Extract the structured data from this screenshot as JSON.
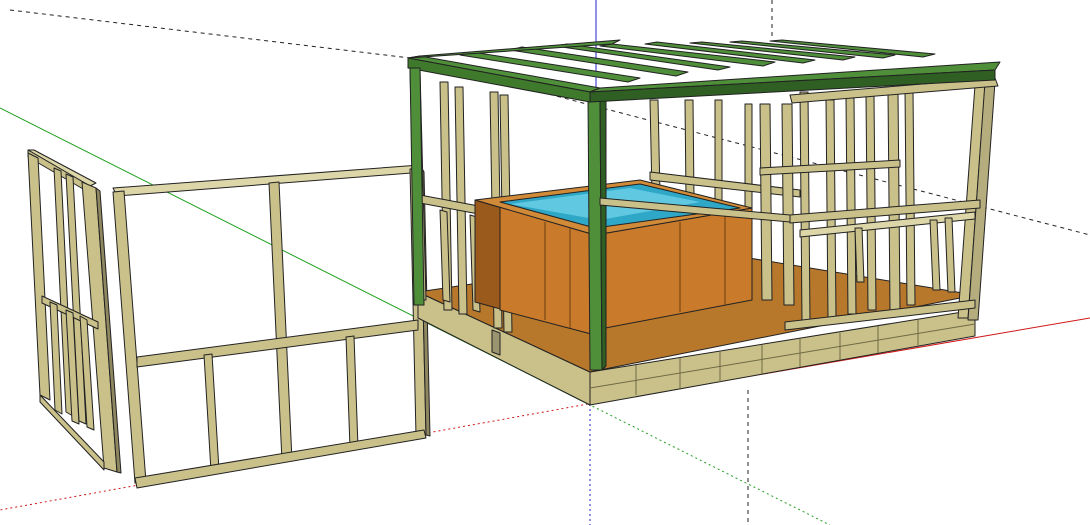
{
  "scene": {
    "description_visible_text": "",
    "colors": {
      "background": "#ffffff",
      "axis_red": "#d01818",
      "axis_green": "#20a020",
      "axis_blue": "#2020c8",
      "lumber": "#c9c08a",
      "lumber_dark": "#6f6a45",
      "lumber_light": "#ddd6a8",
      "roof_green": "#4f8f3a",
      "roof_green_dark": "#2f5f22",
      "floor": "#b8782c",
      "tub_wood": "#c97a2a",
      "tub_wood_dark": "#9a5a1c",
      "water": "#2fa8c8",
      "water_light": "#60c8e0",
      "edge": "#222222"
    }
  }
}
